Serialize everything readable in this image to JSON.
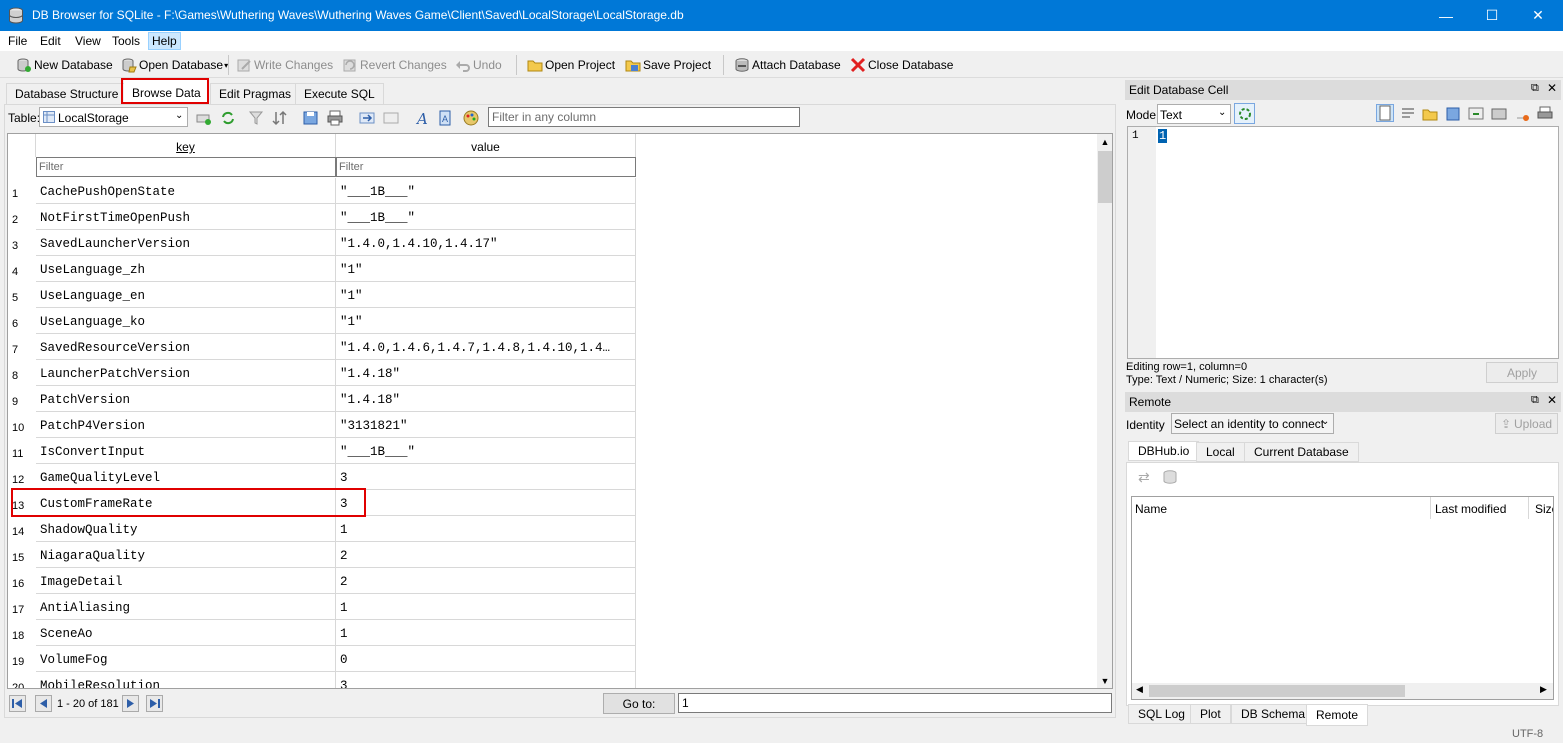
{
  "window": {
    "title": "DB Browser for SQLite - F:\\Games\\Wuthering Waves\\Wuthering Waves Game\\Client\\Saved\\LocalStorage\\LocalStorage.db",
    "minimize": "—",
    "maximize": "☐",
    "close": "✕"
  },
  "menu": [
    "File",
    "Edit",
    "View",
    "Tools",
    "Help"
  ],
  "toolbar": {
    "new_db": "New Database",
    "open_db": "Open Database",
    "write_changes": "Write Changes",
    "revert_changes": "Revert Changes",
    "undo": "Undo",
    "open_project": "Open Project",
    "save_project": "Save Project",
    "attach_db": "Attach Database",
    "close_db": "Close Database"
  },
  "tabs": [
    "Database Structure",
    "Browse Data",
    "Edit Pragmas",
    "Execute SQL"
  ],
  "browse": {
    "table_label": "Table:",
    "table_value": "LocalStorage",
    "filter_any_placeholder": "Filter in any column",
    "columns": [
      "key",
      "value"
    ],
    "filter_placeholder": "Filter",
    "rows": [
      {
        "n": "1",
        "key": "CachePushOpenState",
        "value": "\"___1B___\""
      },
      {
        "n": "2",
        "key": "NotFirstTimeOpenPush",
        "value": "\"___1B___\""
      },
      {
        "n": "3",
        "key": "SavedLauncherVersion",
        "value": "\"1.4.0,1.4.10,1.4.17\""
      },
      {
        "n": "4",
        "key": "UseLanguage_zh",
        "value": "\"1\""
      },
      {
        "n": "5",
        "key": "UseLanguage_en",
        "value": "\"1\""
      },
      {
        "n": "6",
        "key": "UseLanguage_ko",
        "value": "\"1\""
      },
      {
        "n": "7",
        "key": "SavedResourceVersion",
        "value": "\"1.4.0,1.4.6,1.4.7,1.4.8,1.4.10,1.4…"
      },
      {
        "n": "8",
        "key": "LauncherPatchVersion",
        "value": "\"1.4.18\""
      },
      {
        "n": "9",
        "key": "PatchVersion",
        "value": "\"1.4.18\""
      },
      {
        "n": "10",
        "key": "PatchP4Version",
        "value": "\"3131821\""
      },
      {
        "n": "11",
        "key": "IsConvertInput",
        "value": "\"___1B___\""
      },
      {
        "n": "12",
        "key": "GameQualityLevel",
        "value": "3"
      },
      {
        "n": "13",
        "key": "CustomFrameRate",
        "value": "3"
      },
      {
        "n": "14",
        "key": "ShadowQuality",
        "value": "1"
      },
      {
        "n": "15",
        "key": "NiagaraQuality",
        "value": "2"
      },
      {
        "n": "16",
        "key": "ImageDetail",
        "value": "2"
      },
      {
        "n": "17",
        "key": "AntiAliasing",
        "value": "1"
      },
      {
        "n": "18",
        "key": "SceneAo",
        "value": "1"
      },
      {
        "n": "19",
        "key": "VolumeFog",
        "value": "0"
      },
      {
        "n": "20",
        "key": "MobileResolution",
        "value": "3"
      }
    ],
    "record_count": "1 - 20 of 181",
    "goto_label": "Go to:",
    "goto_value": "1"
  },
  "edit_cell": {
    "title": "Edit Database Cell",
    "mode_label": "Mode:",
    "mode_value": "Text",
    "line_number": "1",
    "cell_text": "1",
    "editing_info": "Editing row=1, column=0",
    "type_info": "Type: Text / Numeric; Size: 1 character(s)",
    "apply": "Apply"
  },
  "remote": {
    "title": "Remote",
    "identity_label": "Identity",
    "identity_value": "Select an identity to connect",
    "upload": "Upload",
    "tabs": [
      "DBHub.io",
      "Local",
      "Current Database"
    ],
    "columns": [
      "Name",
      "Last modified",
      "Size"
    ]
  },
  "bottom_tabs": [
    "SQL Log",
    "Plot",
    "DB Schema",
    "Remote"
  ],
  "status": {
    "encoding": "UTF-8"
  },
  "colors": {
    "titlebar": "#0078d7",
    "highlight": "#e00000",
    "selection": "#0063b1"
  }
}
